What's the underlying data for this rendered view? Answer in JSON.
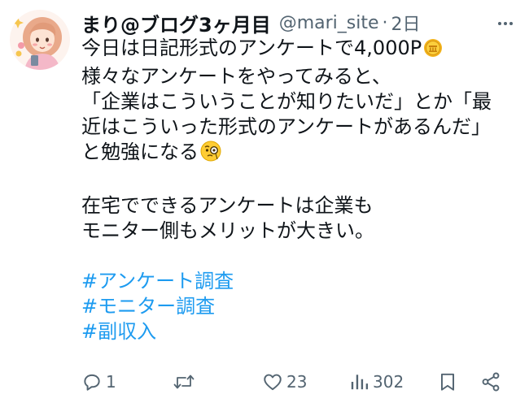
{
  "author": {
    "display_name": "まり@ブログ3ヶ月目",
    "handle": "@mari_site",
    "separator": "·",
    "time": "2日"
  },
  "tweet": {
    "lines": [
      "今日は日記形式のアンケートで4,000P",
      "様々なアンケートをやってみると、",
      "「企業はこういうことが知りたいだ」とか「最",
      "近はこういった形式のアンケートがあるんだ」",
      "と勉強になる",
      "在宅でできるアンケートは企業も",
      "モニター側もメリットが大きい。"
    ],
    "hashtags": [
      "#アンケート調査",
      "#モニター調査",
      "#副収入"
    ],
    "emojis": [
      "coin-emoji",
      "monocle-face-emoji"
    ]
  },
  "actions": {
    "reply_count": "1",
    "repost_count": "",
    "like_count": "23",
    "view_count": "302"
  },
  "colors": {
    "text": "#0f1419",
    "secondary": "#536471",
    "link": "#1d9bf0"
  }
}
